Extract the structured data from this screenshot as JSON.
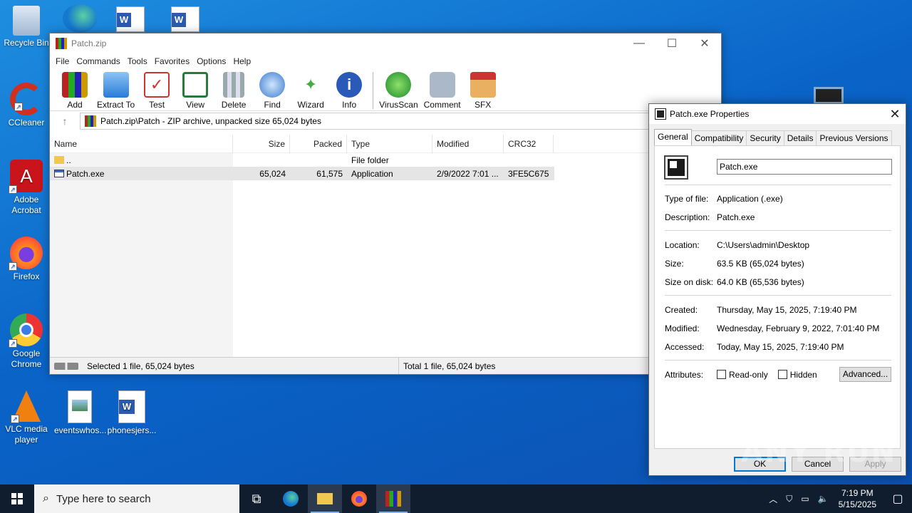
{
  "desktop": {
    "icons": [
      {
        "label": "Recycle Bin"
      },
      {
        "label": "CCleaner"
      },
      {
        "label": "Adobe Acrobat"
      },
      {
        "label": "Firefox"
      },
      {
        "label": "Google Chrome"
      },
      {
        "label": "VLC media player"
      },
      {
        "label": "eventswhos..."
      },
      {
        "label": "phonesjers..."
      }
    ]
  },
  "winrar": {
    "title": "Patch.zip",
    "menu": [
      "File",
      "Commands",
      "Tools",
      "Favorites",
      "Options",
      "Help"
    ],
    "toolbar": [
      "Add",
      "Extract To",
      "Test",
      "View",
      "Delete",
      "Find",
      "Wizard",
      "Info",
      "VirusScan",
      "Comment",
      "SFX"
    ],
    "address": "Patch.zip\\Patch - ZIP archive, unpacked size 65,024 bytes",
    "columns": {
      "name": "Name",
      "size": "Size",
      "packed": "Packed",
      "type": "Type",
      "modified": "Modified",
      "crc": "CRC32"
    },
    "rows": [
      {
        "name": "..",
        "size": "",
        "packed": "",
        "type": "File folder",
        "modified": "",
        "crc": ""
      },
      {
        "name": "Patch.exe",
        "size": "65,024",
        "packed": "61,575",
        "type": "Application",
        "modified": "2/9/2022 7:01 ...",
        "crc": "3FE5C675"
      }
    ],
    "status_left": "Selected 1 file, 65,024 bytes",
    "status_right": "Total 1 file, 65,024 bytes"
  },
  "properties": {
    "title": "Patch.exe Properties",
    "tabs": [
      "General",
      "Compatibility",
      "Security",
      "Details",
      "Previous Versions"
    ],
    "filename": "Patch.exe",
    "type_label": "Type of file:",
    "type_value": "Application (.exe)",
    "desc_label": "Description:",
    "desc_value": "Patch.exe",
    "loc_label": "Location:",
    "loc_value": "C:\\Users\\admin\\Desktop",
    "size_label": "Size:",
    "size_value": "63.5 KB (65,024 bytes)",
    "disk_label": "Size on disk:",
    "disk_value": "64.0 KB (65,536 bytes)",
    "created_label": "Created:",
    "created_value": "Thursday, May 15, 2025, 7:19:40 PM",
    "modified_label": "Modified:",
    "modified_value": "Wednesday, February 9, 2022, 7:01:40 PM",
    "accessed_label": "Accessed:",
    "accessed_value": "Today, May 15, 2025, 7:19:40 PM",
    "attr_label": "Attributes:",
    "readonly": "Read-only",
    "hidden": "Hidden",
    "advanced": "Advanced...",
    "ok": "OK",
    "cancel": "Cancel",
    "apply": "Apply"
  },
  "watermark": "ANY RUN",
  "taskbar": {
    "search_placeholder": "Type here to search",
    "time": "7:19 PM",
    "date": "5/15/2025"
  }
}
